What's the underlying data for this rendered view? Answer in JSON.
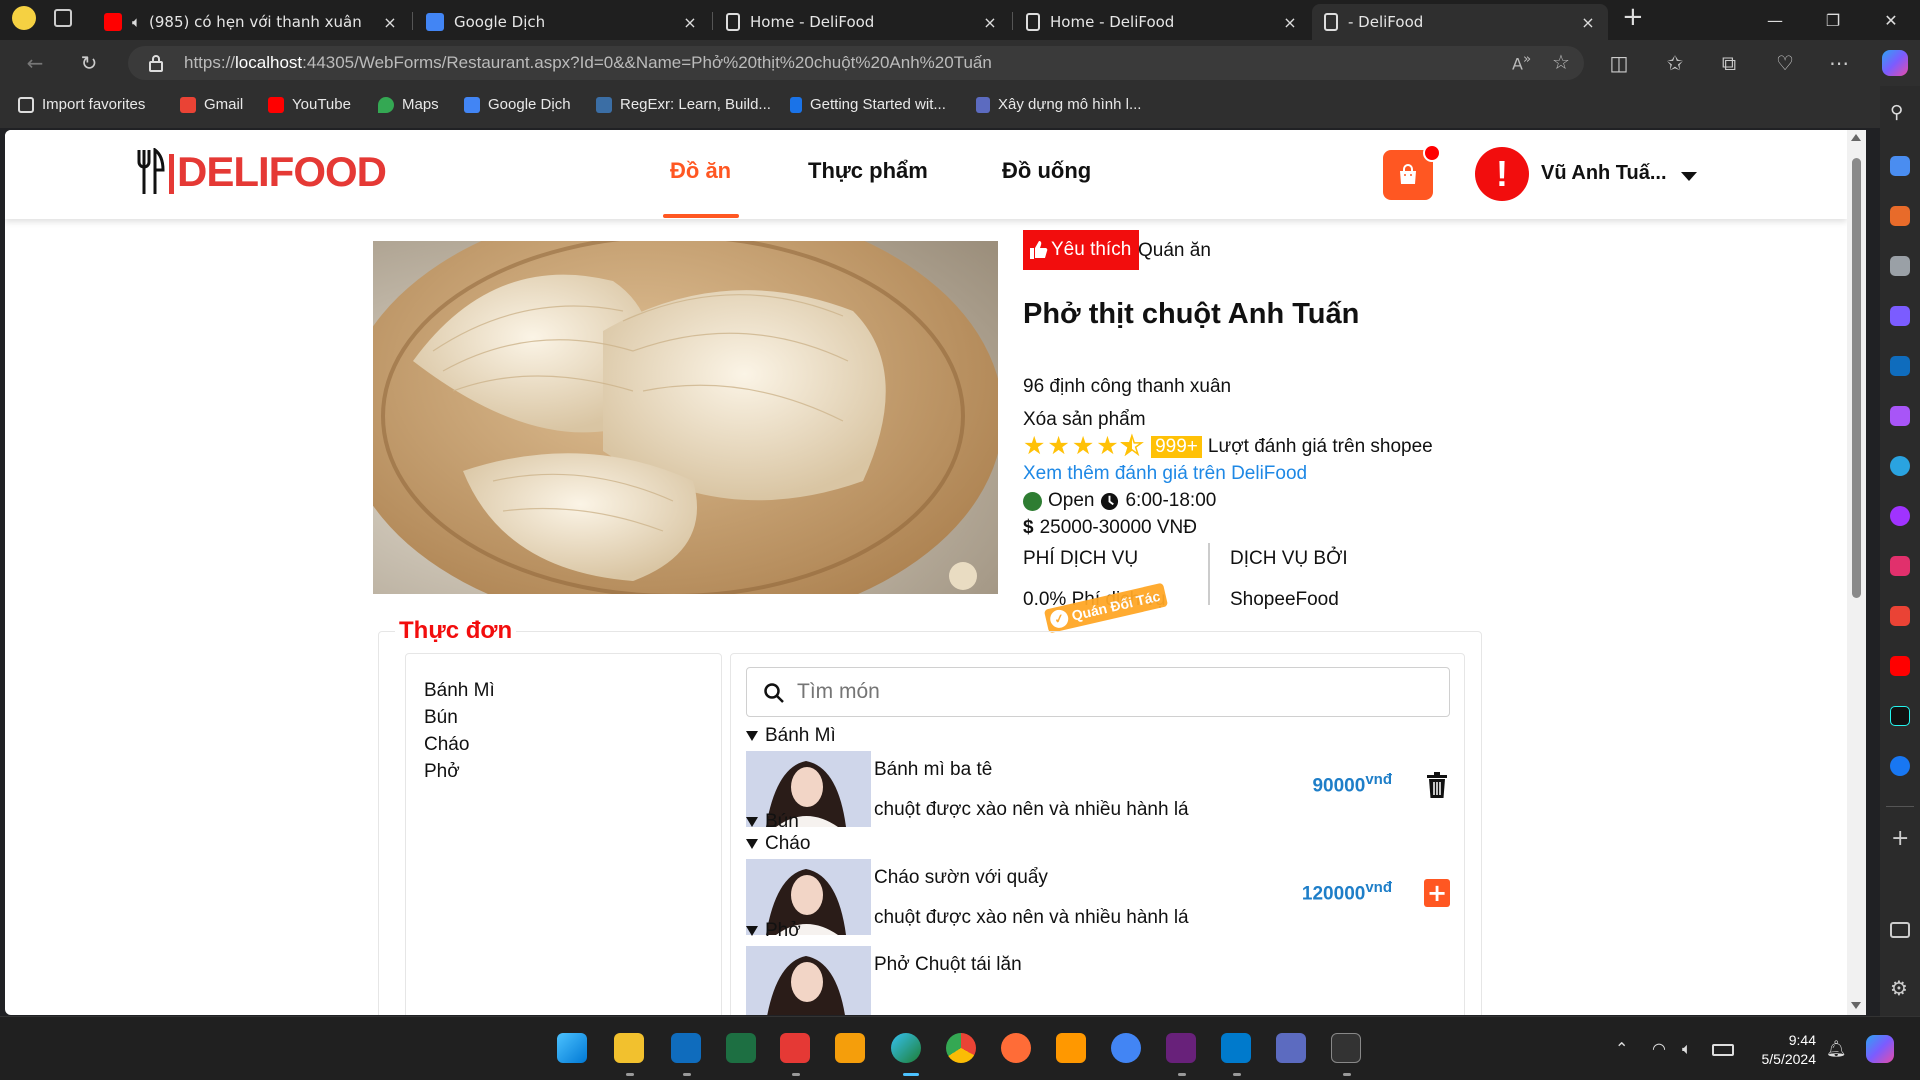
{
  "browser": {
    "tabs": [
      {
        "title": "(985) có hẹn với thanh xuân",
        "close": "×",
        "active": false
      },
      {
        "title": "Google Dịch",
        "close": "×",
        "active": false
      },
      {
        "title": "Home - DeliFood",
        "close": "×",
        "active": false
      },
      {
        "title": "Home - DeliFood",
        "close": "×",
        "active": false
      },
      {
        "title": "- DeliFood",
        "close": "×",
        "active": true
      }
    ],
    "new_tab": "+",
    "window_controls": {
      "minimize": "—",
      "maximize": "❐",
      "close": "✕"
    },
    "url": {
      "scheme": "https://",
      "host": "localhost",
      "rest": ":44305/WebForms/Restaurant.aspx?Id=0&&Name=Phở%20thịt%20chuột%20Anh%20Tuấn"
    },
    "favorites": [
      {
        "label": "Import favorites",
        "icon": "import-icon"
      },
      {
        "label": "Gmail",
        "icon": "gmail-icon"
      },
      {
        "label": "YouTube",
        "icon": "youtube-icon"
      },
      {
        "label": "Maps",
        "icon": "maps-icon"
      },
      {
        "label": "Google Dịch",
        "icon": "translate-icon"
      },
      {
        "label": "RegExr: Learn, Build...",
        "icon": "regexr-icon"
      },
      {
        "label": "Getting Started wit...",
        "icon": "k-icon"
      },
      {
        "label": "Xây dựng mô hình l...",
        "icon": "v-icon"
      }
    ]
  },
  "site": {
    "logo_text": "DELIFOOD",
    "nav": [
      {
        "label": "Đồ ăn",
        "active": true
      },
      {
        "label": "Thực phẩm",
        "active": false
      },
      {
        "label": "Đồ uống",
        "active": false
      }
    ],
    "user": {
      "avatar_glyph": "!",
      "name": "Vũ Anh Tuấ..."
    },
    "colors": {
      "brand_red": "#e53935",
      "accent_orange": "#ff5722",
      "link_blue": "#1e88e5",
      "price_blue": "#1e7ec8",
      "star_yellow": "#ffc107",
      "open_green": "#2e7d32"
    }
  },
  "restaurant": {
    "favorite_label": "Yêu thích",
    "category": "Quán ăn",
    "name": "Phở thịt chuột Anh Tuấn",
    "address": "96 định công thanh xuân",
    "delete_label": "Xóa sản phẩm",
    "rating": 4.5,
    "review_count": "999+",
    "review_text": "Lượt đánh giá trên shopee",
    "more_reviews": "Xem thêm đánh giá trên DeliFood",
    "status": "Open",
    "hours": "6:00-18:00",
    "currency_symbol": "$",
    "price_range": "25000-30000 VNĐ",
    "service_fee_label": "PHÍ DỊCH VỤ",
    "service_fee_value": "0.0% Phí dịch vụ",
    "service_by_label": "DỊCH VỤ BỞI",
    "service_by_value": "ShopeeFood",
    "partner_tag": "Quán Đối Tác"
  },
  "menu": {
    "title": "Thực đơn",
    "categories": [
      "Bánh Mì",
      "Bún",
      "Cháo",
      "Phở"
    ],
    "search_placeholder": "Tìm món",
    "groups": [
      {
        "name": "Bánh Mì",
        "dishes": [
          {
            "name": "Bánh mì ba tê",
            "description": "chuột được xào nên và nhiều hành lá",
            "price": "90000",
            "unit": "vnđ",
            "action": "delete"
          }
        ]
      },
      {
        "name": "Bún",
        "dishes": []
      },
      {
        "name": "Cháo",
        "dishes": [
          {
            "name": "Cháo sườn với quẩy",
            "description": "chuột được xào nên và nhiều hành lá",
            "price": "120000",
            "unit": "vnđ",
            "action": "add"
          }
        ]
      },
      {
        "name": "Phở",
        "dishes": [
          {
            "name": "Phở Chuột tái lăn",
            "description": "",
            "price": "",
            "unit": "",
            "action": ""
          }
        ]
      }
    ]
  },
  "taskbar": {
    "time": "9:44",
    "date": "5/5/2024"
  }
}
